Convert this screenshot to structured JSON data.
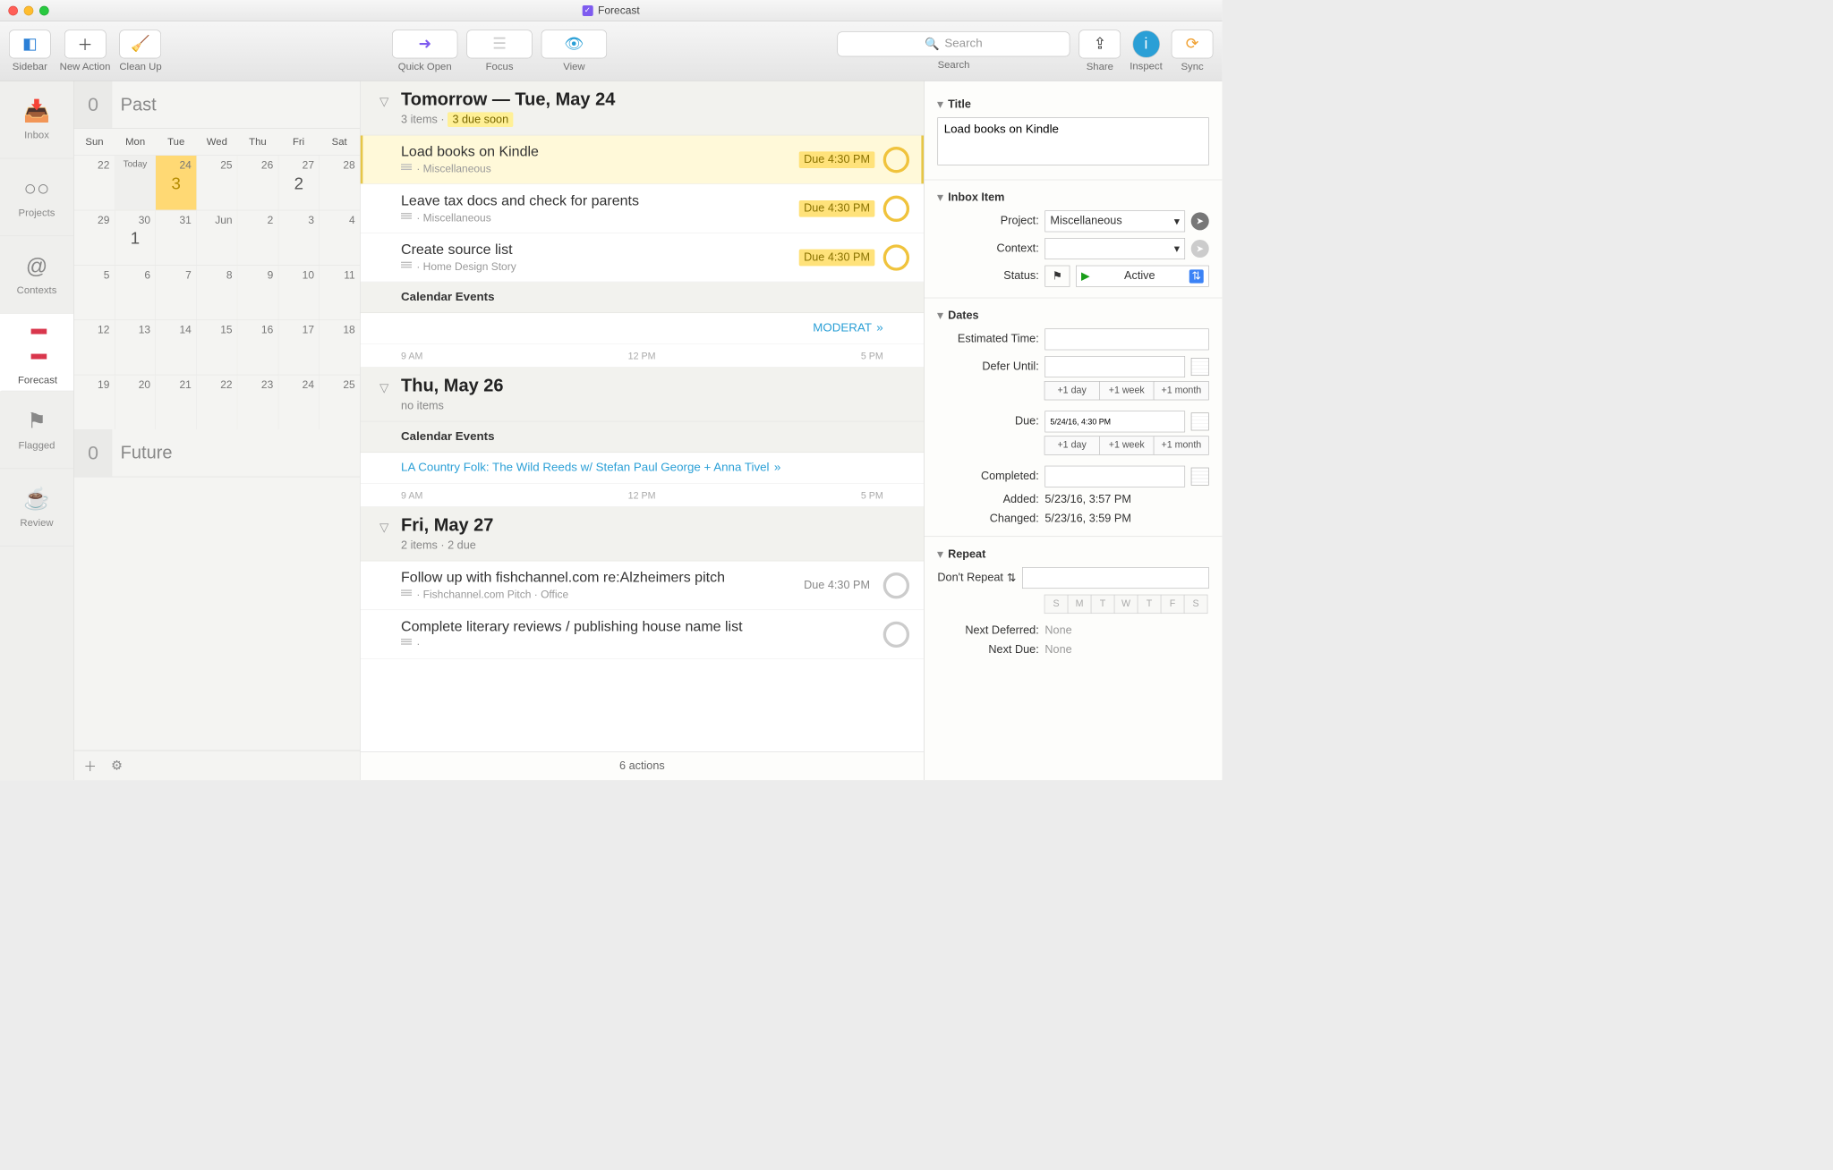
{
  "window": {
    "title": "Forecast"
  },
  "toolbar": {
    "sidebar": "Sidebar",
    "newaction": "New Action",
    "cleanup": "Clean Up",
    "quickopen": "Quick Open",
    "focus": "Focus",
    "view": "View",
    "search_placeholder": "Search",
    "search": "Search",
    "share": "Share",
    "inspect": "Inspect",
    "sync": "Sync"
  },
  "sidebar": {
    "inbox": "Inbox",
    "projects": "Projects",
    "contexts": "Contexts",
    "forecast": "Forecast",
    "flagged": "Flagged",
    "review": "Review"
  },
  "calendar": {
    "past_count": "0",
    "past_label": "Past",
    "future_count": "0",
    "future_label": "Future",
    "dow": [
      "Sun",
      "Mon",
      "Tue",
      "Wed",
      "Thu",
      "Fri",
      "Sat"
    ],
    "rows": [
      [
        {
          "d": "22"
        },
        {
          "d": "Today"
        },
        {
          "d": "24",
          "b": "3",
          "sel": true
        },
        {
          "d": "25"
        },
        {
          "d": "26"
        },
        {
          "d": "27",
          "b": "2"
        },
        {
          "d": "28"
        }
      ],
      [
        {
          "d": "29"
        },
        {
          "d": "30",
          "b": "1"
        },
        {
          "d": "31"
        },
        {
          "d": "Jun"
        },
        {
          "d": "2"
        },
        {
          "d": "3"
        },
        {
          "d": "4"
        }
      ],
      [
        {
          "d": "5"
        },
        {
          "d": "6"
        },
        {
          "d": "7"
        },
        {
          "d": "8"
        },
        {
          "d": "9"
        },
        {
          "d": "10"
        },
        {
          "d": "11"
        }
      ],
      [
        {
          "d": "12"
        },
        {
          "d": "13"
        },
        {
          "d": "14"
        },
        {
          "d": "15"
        },
        {
          "d": "16"
        },
        {
          "d": "17"
        },
        {
          "d": "18"
        }
      ],
      [
        {
          "d": "19"
        },
        {
          "d": "20"
        },
        {
          "d": "21"
        },
        {
          "d": "22"
        },
        {
          "d": "23"
        },
        {
          "d": "24"
        },
        {
          "d": "25"
        }
      ]
    ]
  },
  "list": {
    "day1": {
      "title": "Tomorrow — Tue, May 24",
      "sub_prefix": "3 items · ",
      "due_soon": "3 due soon",
      "tasks": [
        {
          "title": "Load books on Kindle",
          "meta": "Miscellaneous",
          "due": "Due 4:30 PM",
          "hl": true,
          "sel": true
        },
        {
          "title": "Leave tax docs and check for parents",
          "meta": "Miscellaneous",
          "due": "Due 4:30 PM",
          "hl": true
        },
        {
          "title": "Create source list",
          "meta": "Home Design Story",
          "due": "Due 4:30 PM",
          "hl": true
        }
      ],
      "cal_header": "Calendar Events",
      "event": "MODERAT",
      "t1": "9 AM",
      "t2": "12 PM",
      "t3": "5 PM"
    },
    "day2": {
      "title": "Thu, May 26",
      "sub": "no items",
      "cal_header": "Calendar Events",
      "event": "LA Country Folk: The Wild Reeds w/ Stefan Paul George + Anna Tivel",
      "t1": "9 AM",
      "t2": "12 PM",
      "t3": "5 PM"
    },
    "day3": {
      "title": "Fri, May 27",
      "sub": "2 items · 2 due",
      "tasks": [
        {
          "title": "Follow up with fishchannel.com re:Alzheimers pitch",
          "meta": "Fishchannel.com Pitch · Office",
          "due": "Due 4:30 PM"
        },
        {
          "title": "Complete literary reviews / publishing house name list",
          "meta": "",
          "due": ""
        }
      ]
    },
    "status": "6 actions"
  },
  "inspector": {
    "title_label": "Title",
    "title_value": "Load books on Kindle",
    "inbox_label": "Inbox Item",
    "project_label": "Project:",
    "project_value": "Miscellaneous",
    "context_label": "Context:",
    "context_value": "",
    "status_label": "Status:",
    "status_value": "Active",
    "dates_label": "Dates",
    "est_label": "Estimated Time:",
    "defer_label": "Defer Until:",
    "defer_value": "",
    "seg_day": "+1 day",
    "seg_week": "+1 week",
    "seg_month": "+1 month",
    "due_label": "Due:",
    "due_value": "5/24/16, 4:30 PM",
    "completed_label": "Completed:",
    "added_label": "Added:",
    "added_value": "5/23/16, 3:57 PM",
    "changed_label": "Changed:",
    "changed_value": "5/23/16, 3:59 PM",
    "repeat_label": "Repeat",
    "repeat_mode": "Don't Repeat",
    "dow": [
      "S",
      "M",
      "T",
      "W",
      "T",
      "F",
      "S"
    ],
    "next_defer_label": "Next Deferred:",
    "next_defer_value": "None",
    "next_due_label": "Next Due:",
    "next_due_value": "None"
  }
}
